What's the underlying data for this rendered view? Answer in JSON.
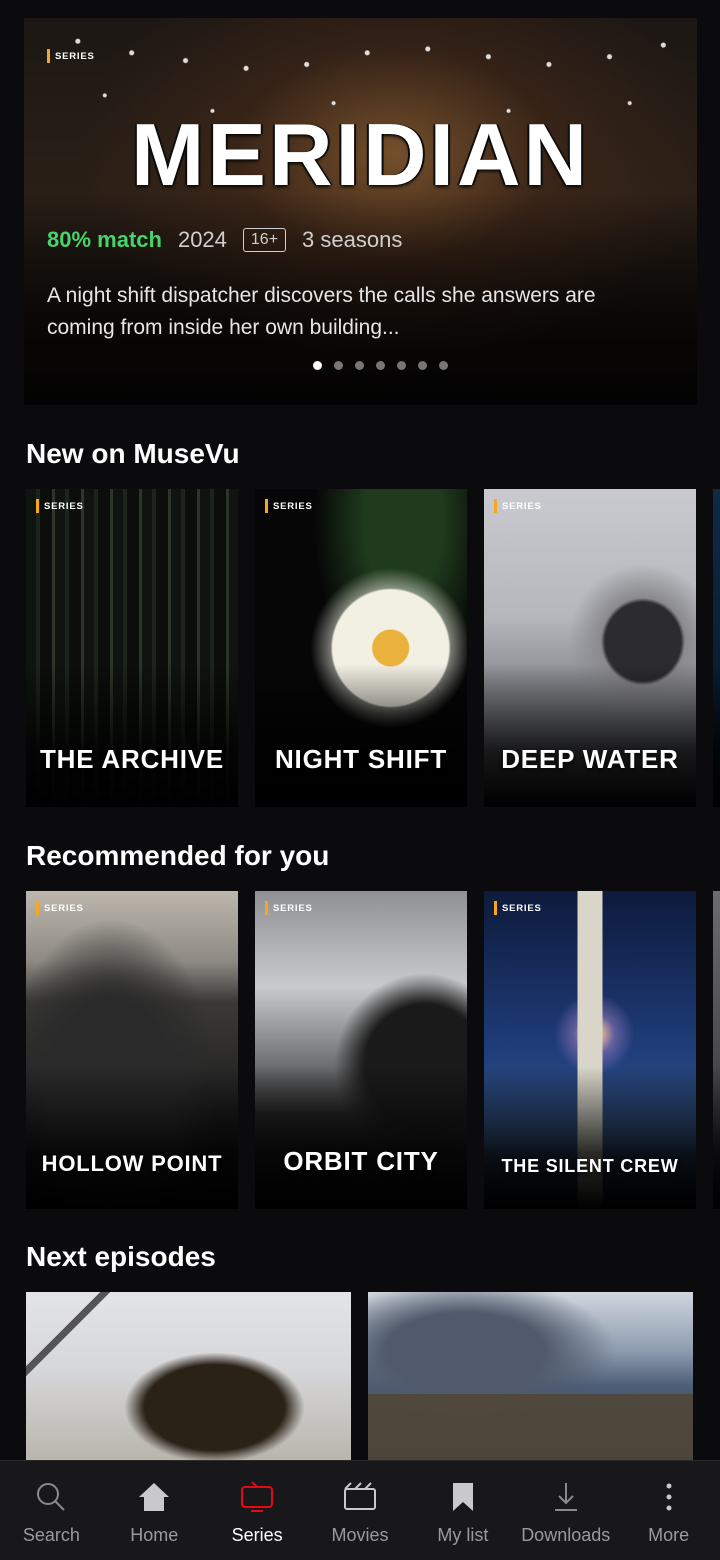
{
  "hero": {
    "tag": "SERIES",
    "title": "MERIDIAN",
    "match": "80% match",
    "year": "2024",
    "rating": "16+",
    "seasons": "3 seasons",
    "description": "A night shift dispatcher discovers the calls she answers are coming from inside her own building...",
    "carousel_count": 7,
    "carousel_active": 1
  },
  "sections": {
    "new": {
      "title": "New on MuseVu",
      "cards": [
        {
          "tag": "SERIES",
          "title": "THE ARCHIVE"
        },
        {
          "tag": "SERIES",
          "title": "NIGHT SHIFT"
        },
        {
          "tag": "SERIES",
          "title": "DEEP WATER"
        }
      ]
    },
    "recommended": {
      "title": "Recommended for you",
      "cards": [
        {
          "tag": "SERIES",
          "title": "HOLLOW POINT"
        },
        {
          "tag": "SERIES",
          "title": "ORBIT CITY"
        },
        {
          "tag": "SERIES",
          "title": "THE SILENT CREW"
        }
      ]
    },
    "next": {
      "title": "Next episodes"
    }
  },
  "nav": {
    "items": [
      {
        "label": "Search",
        "icon": "search-icon"
      },
      {
        "label": "Home",
        "icon": "home-icon"
      },
      {
        "label": "Series",
        "icon": "tv-icon"
      },
      {
        "label": "Movies",
        "icon": "clapper-icon"
      },
      {
        "label": "My list",
        "icon": "bookmark-icon"
      },
      {
        "label": "Downloads",
        "icon": "download-icon"
      },
      {
        "label": "More",
        "icon": "more-vertical-icon"
      }
    ],
    "active": "Series"
  },
  "colors": {
    "background": "#0b0b0d",
    "match": "#46d369",
    "tag_accent": "#f5a623",
    "nav_active_icon": "#e50914",
    "nav_bg": "#18181b"
  }
}
